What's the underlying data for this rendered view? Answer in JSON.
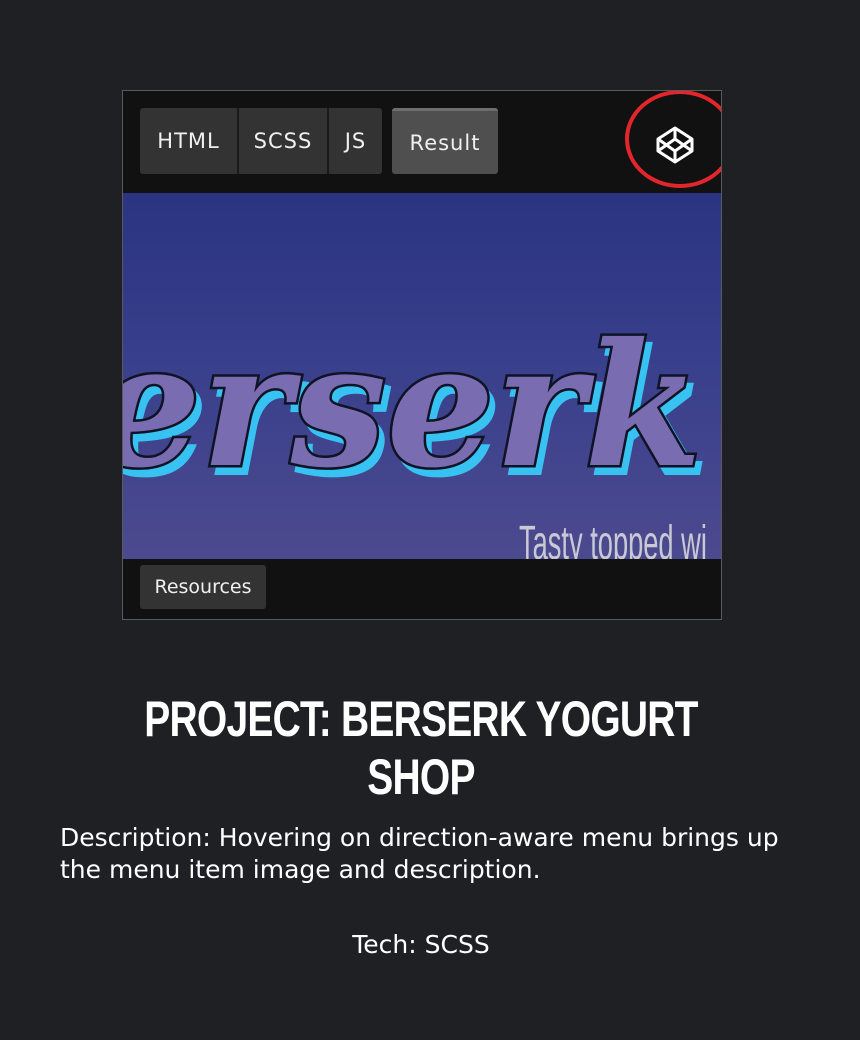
{
  "embed": {
    "tabs": [
      {
        "label": "HTML"
      },
      {
        "label": "SCSS"
      },
      {
        "label": "JS"
      }
    ],
    "result_tab": {
      "label": "Result",
      "active": true
    },
    "logo_icon": "codepen-icon",
    "highlight_color": "#e3262b",
    "preview": {
      "logo_text": "erserk",
      "tagline": "Tasty topped wi",
      "logo_fill": "#7a6cb0",
      "logo_shadow": "#37c2f2"
    },
    "resources_label": "Resources"
  },
  "project": {
    "title": "PROJECT: BERSERK YOGURT SHOP",
    "description": "Description: Hovering on direction-aware menu brings up the menu item image and description.",
    "tech": "Tech: SCSS"
  }
}
